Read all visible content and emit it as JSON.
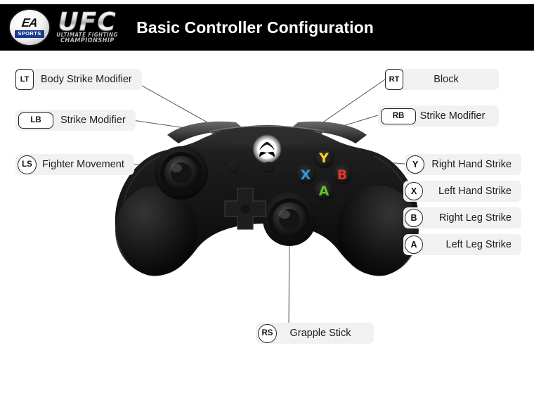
{
  "header": {
    "title": "Basic Controller Configuration",
    "brand": {
      "ea_mark": "EA",
      "ea_sports": "SPORTS",
      "ufc_word": "UFC",
      "ufc_sub1": "ULTIMATE FIGHTING",
      "ufc_sub2": "CHAMPIONSHIP"
    },
    "background_color": "#000000",
    "title_color": "#ffffff"
  },
  "callouts": {
    "left": [
      {
        "badge": "LT",
        "label": "Body Strike Modifier",
        "shape": "rect-tall"
      },
      {
        "badge": "LB",
        "label": "Strike Modifier",
        "shape": "rect-wide"
      },
      {
        "badge": "LS",
        "label": "Fighter Movement",
        "shape": "circ"
      }
    ],
    "right": [
      {
        "badge": "RT",
        "label": "Block",
        "shape": "rect-tall"
      },
      {
        "badge": "RB",
        "label": "Strike Modifier",
        "shape": "rect-wide"
      },
      {
        "badge": "Y",
        "label": "Right Hand Strike",
        "shape": "circ-sm"
      },
      {
        "badge": "X",
        "label": "Left Hand Strike",
        "shape": "circ-sm"
      },
      {
        "badge": "B",
        "label": "Right Leg Strike",
        "shape": "circ-sm"
      },
      {
        "badge": "A",
        "label": "Left Leg Strike",
        "shape": "circ-sm"
      }
    ],
    "bottom": [
      {
        "badge": "RS",
        "label": "Grapple Stick",
        "shape": "circ"
      }
    ]
  },
  "controller": {
    "type": "xbox-one-controller",
    "body_color": "#111111",
    "face_buttons": [
      {
        "letter": "Y",
        "color": "#ffd21f",
        "position": "top"
      },
      {
        "letter": "X",
        "color": "#2e9bdf",
        "position": "left"
      },
      {
        "letter": "B",
        "color": "#e8322a",
        "position": "right"
      },
      {
        "letter": "A",
        "color": "#63c12a",
        "position": "bottom"
      }
    ],
    "guide_button": "xbox-logo",
    "sticks": [
      "left-stick",
      "right-stick"
    ],
    "dpad": "directional-pad",
    "small_buttons": [
      "view-button",
      "menu-button"
    ]
  },
  "style": {
    "pill_background": "#f1f1f1",
    "badge_border": "#232323",
    "leader_line_color": "#555555",
    "page_background": "#ffffff"
  }
}
